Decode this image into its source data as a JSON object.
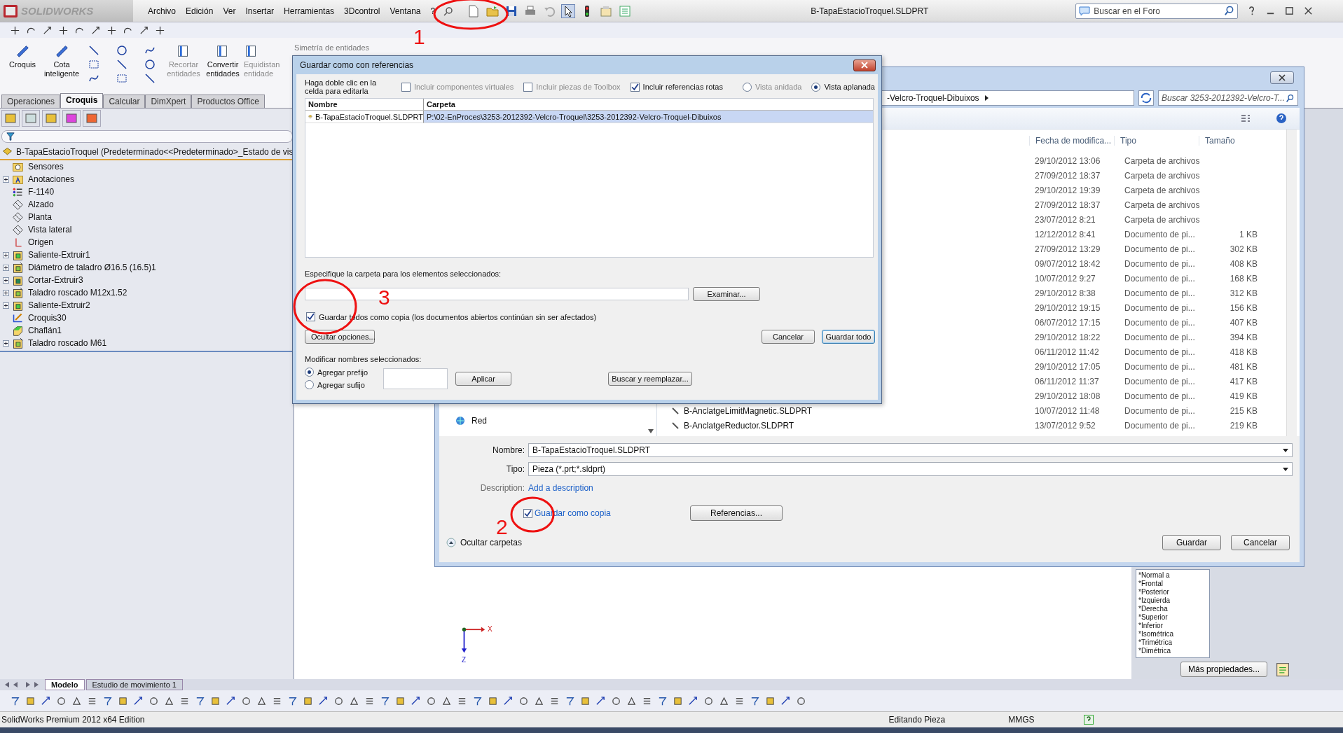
{
  "app": {
    "logo": "SOLIDWORKS",
    "menu": [
      "Archivo",
      "Edición",
      "Ver",
      "Insertar",
      "Herramientas",
      "3Dcontrol",
      "Ventana",
      "?"
    ],
    "document_title": "B-TapaEstacioTroquel.SLDPRT",
    "search": {
      "placeholder": "Buscar en el Foro"
    }
  },
  "command_manager": {
    "buttons": [
      {
        "label": "Croquis",
        "disabled": false
      },
      {
        "label": "Cota inteligente",
        "disabled": false
      }
    ],
    "tools": [
      {
        "label": "Recortar entidades",
        "disabled": true
      },
      {
        "label": "Convertir entidades",
        "disabled": false
      },
      {
        "label": "Equidistan entidade",
        "disabled": true
      }
    ],
    "mirror_label": "Simetría de entidades",
    "tabs": [
      {
        "label": "Operaciones",
        "selected": false
      },
      {
        "label": "Croquis",
        "selected": true
      },
      {
        "label": "Calcular",
        "selected": false
      },
      {
        "label": "DimXpert",
        "selected": false
      },
      {
        "label": "Productos Office",
        "selected": false
      }
    ]
  },
  "feature_tree": {
    "root": "B-TapaEstacioTroquel  (Predeterminado<<Predeterminado>_Estado de vis",
    "items": [
      {
        "label": "Sensores",
        "kind": "sensors",
        "expandable": false
      },
      {
        "label": "Anotaciones",
        "kind": "annotations",
        "expandable": true
      },
      {
        "label": "F-1140",
        "kind": "material",
        "expandable": false
      },
      {
        "label": "Alzado",
        "kind": "plane",
        "expandable": false
      },
      {
        "label": "Planta",
        "kind": "plane",
        "expandable": false
      },
      {
        "label": "Vista lateral",
        "kind": "plane",
        "expandable": false
      },
      {
        "label": "Origen",
        "kind": "origin",
        "expandable": false
      },
      {
        "label": "Saliente-Extruir1",
        "kind": "extrude",
        "expandable": true
      },
      {
        "label": "Diámetro de taladro Ø16.5 (16.5)1",
        "kind": "hole",
        "expandable": true
      },
      {
        "label": "Cortar-Extruir3",
        "kind": "cut",
        "expandable": true
      },
      {
        "label": "Taladro roscado M12x1.52",
        "kind": "hole",
        "expandable": true
      },
      {
        "label": "Saliente-Extruir2",
        "kind": "extrude",
        "expandable": true
      },
      {
        "label": "Croquis30",
        "kind": "sketch",
        "expandable": false
      },
      {
        "label": "Chaflán1",
        "kind": "chamfer",
        "expandable": false
      },
      {
        "label": "Taladro roscado M61",
        "kind": "hole",
        "expandable": true
      }
    ]
  },
  "graphics": {
    "triad": [
      "X",
      "Z"
    ]
  },
  "task_pane": {
    "views": [
      "*Normal a",
      "*Frontal",
      "*Posterior",
      "*Izquierda",
      "*Derecha",
      "*Superior",
      "*Inferior",
      "*Isométrica",
      "*Trimétrica",
      "*Dimétrica"
    ],
    "button": "Más propiedades..."
  },
  "save_dialog": {
    "address": "-Velcro-Troquel-Dibuixos",
    "search": {
      "placeholder": "Buscar 3253-2012392-Velcro-T..."
    },
    "columns": [
      "Fecha de modifica...",
      "Tipo",
      "Tamaño"
    ],
    "files": [
      {
        "date": "29/10/2012 13:06",
        "type": "Carpeta de archivos"
      },
      {
        "date": "27/09/2012 18:37",
        "type": "Carpeta de archivos"
      },
      {
        "date": "29/10/2012 19:39",
        "type": "Carpeta de archivos"
      },
      {
        "date": "27/09/2012 18:37",
        "type": "Carpeta de archivos"
      },
      {
        "date": "23/07/2012 8:21",
        "type": "Carpeta de archivos"
      },
      {
        "date": "12/12/2012 8:41",
        "type": "Documento de pi...",
        "size": "1 KB"
      },
      {
        "date": "27/09/2012 13:29",
        "type": "Documento de pi...",
        "size": "302 KB"
      },
      {
        "date": "09/07/2012 18:42",
        "type": "Documento de pi...",
        "size": "408 KB"
      },
      {
        "date": "10/07/2012 9:27",
        "type": "Documento de pi...",
        "size": "168 KB"
      },
      {
        "date": "29/10/2012 8:38",
        "type": "Documento de pi...",
        "size": "312 KB"
      },
      {
        "date": "29/10/2012 19:15",
        "type": "Documento de pi...",
        "size": "156 KB"
      },
      {
        "date": "06/07/2012 17:15",
        "type": "Documento de pi...",
        "size": "407 KB"
      },
      {
        "date": "29/10/2012 18:22",
        "type": "Documento de pi...",
        "size": "394 KB"
      },
      {
        "date": "06/11/2012 11:42",
        "type": "Documento de pi...",
        "size": "418 KB"
      },
      {
        "date": "29/10/2012 17:05",
        "type": "Documento de pi...",
        "size": "481 KB"
      },
      {
        "date": "06/11/2012 11:37",
        "type": "Documento de pi...",
        "size": "417 KB"
      },
      {
        "date": "29/10/2012 18:08",
        "type": "Documento de pi...",
        "size": "419 KB"
      },
      {
        "name": "B-AnclatgeLimitMagnetic.SLDPRT",
        "date": "10/07/2012 11:48",
        "type": "Documento de pi...",
        "size": "215 KB"
      },
      {
        "name": "B-AnclatgeReductor.SLDPRT",
        "date": "13/07/2012 9:52",
        "type": "Documento de pi...",
        "size": "219 KB"
      }
    ],
    "nav_item": "Red",
    "name_label": "Nombre:",
    "name_value": "B-TapaEstacioTroquel.SLDPRT",
    "type_label": "Tipo:",
    "type_value": "Pieza (*.prt;*.sldprt)",
    "description_label": "Description:",
    "description_link": "Add a description",
    "copy_checkbox": {
      "label": "Guardar como copia",
      "checked": true
    },
    "references_button": "Referencias...",
    "hide_folders": "Ocultar carpetas",
    "save": "Guardar",
    "cancel": "Cancelar"
  },
  "references_dialog": {
    "title": "Guardar como con referencias",
    "hint": "Haga doble clic en la celda para editarla",
    "options": [
      {
        "label": "Incluir componentes virtuales",
        "checked": false,
        "disabled": true
      },
      {
        "label": "Incluir piezas de Toolbox",
        "checked": false,
        "disabled": true
      },
      {
        "label": "Incluir referencias rotas",
        "checked": true,
        "disabled": false
      }
    ],
    "views": [
      {
        "label": "Vista anidada",
        "selected": false,
        "disabled": true
      },
      {
        "label": "Vista aplanada",
        "selected": true,
        "disabled": false
      }
    ],
    "columns": [
      "Nombre",
      "Carpeta"
    ],
    "rows": [
      {
        "name": "B-TapaEstacioTroquel.SLDPRT",
        "folder": "P:\\02-EnProces\\3253-2012392-Velcro-Troquel\\3253-2012392-Velcro-Troquel-Dibuixos",
        "selected": true
      }
    ],
    "folder_label": "Especifique la carpeta para los elementos seleccionados:",
    "browse": "Examinar...",
    "copy_all": {
      "label": "Guardar todos como copia (los documentos abiertos continúan sin ser afectados)",
      "checked": true
    },
    "hide_options": "Ocultar opciones...",
    "cancel": "Cancelar",
    "save_all": "Guardar todo",
    "rename_label": "Modificar nombres seleccionados:",
    "rename_modes": [
      {
        "label": "Agregar prefijo",
        "selected": true
      },
      {
        "label": "Agregar sufijo",
        "selected": false
      }
    ],
    "apply": "Aplicar",
    "find_replace": "Buscar y reemplazar..."
  },
  "bottom_tabs": [
    {
      "label": "Modelo",
      "selected": true
    },
    {
      "label": "Estudio de movimiento 1",
      "selected": false
    }
  ],
  "status_bar": {
    "edition": "SolidWorks Premium 2012 x64 Edition",
    "mode": "Editando Pieza",
    "units": "MMGS"
  },
  "annotations": [
    {
      "label": "1"
    },
    {
      "label": "3"
    },
    {
      "label": "2"
    }
  ]
}
